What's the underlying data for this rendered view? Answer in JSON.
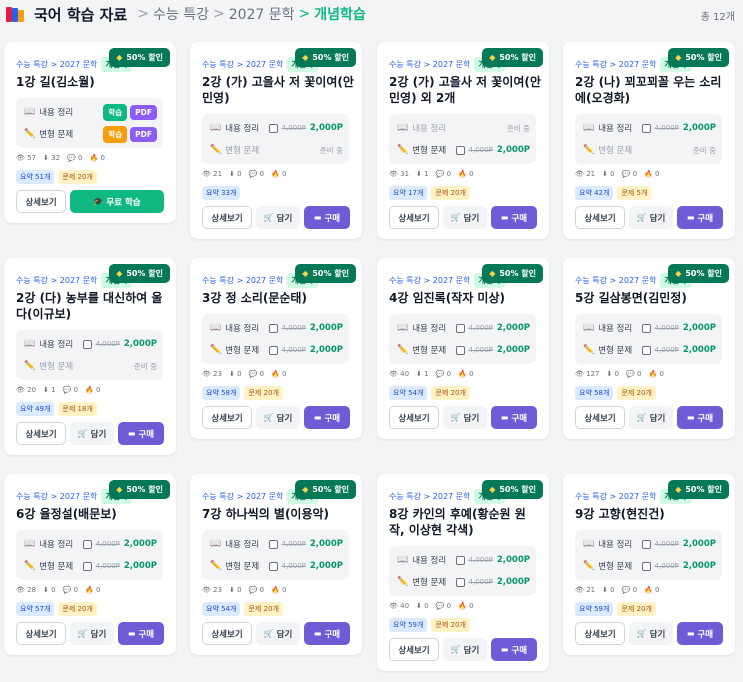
{
  "header": {
    "title": "국어 학습 자료",
    "crumbs": [
      "수능 특강",
      "2027 문학",
      "개념학습"
    ],
    "total": "총 12개"
  },
  "common": {
    "path": "수능 특강 > 2027 문학",
    "tag": "개념학",
    "discount": "50% 할인",
    "summary_label": "내용 정리",
    "variant_label": "변형 문제",
    "orig_price": "4,000P",
    "price": "2,000P",
    "coming_soon": "준비 중",
    "learn_pill": "학습",
    "pdf_pill": "PDF",
    "detail_btn": "상세보기",
    "cart_btn": "담기",
    "buy_btn": "구매",
    "free_btn": "무료 학습"
  },
  "cards": [
    {
      "title": "1강 길(김소월)",
      "views": "57",
      "downloads": "32",
      "comments": "0",
      "likes": "0",
      "summary": "요약 51개",
      "problems": "문제 20개"
    },
    {
      "title": "2강 (가) 고을사 저 꽃이여(안민영)",
      "views": "21",
      "downloads": "0",
      "comments": "0",
      "likes": "0",
      "summary": "요약 33개"
    },
    {
      "title": "2강 (가) 고을사 저 꽃이여(안민영) 외 2개",
      "views": "31",
      "downloads": "1",
      "comments": "0",
      "likes": "0",
      "summary": "요약 17개",
      "problems": "문제 20개"
    },
    {
      "title": "2강 (나) 꾀꼬꾀꼴 우는 소리에(오경화)",
      "views": "21",
      "downloads": "0",
      "comments": "0",
      "likes": "0",
      "summary": "요약 42개",
      "problems": "문제 5개"
    },
    {
      "title": "2강 (다) 농부를 대신하여 울다(이규보)",
      "views": "20",
      "downloads": "1",
      "comments": "0",
      "likes": "0",
      "summary": "요약 49개",
      "problems": "문제 18개"
    },
    {
      "title": "3강 정 소리(문순태)",
      "views": "23",
      "downloads": "0",
      "comments": "0",
      "likes": "0",
      "summary": "요약 58개",
      "problems": "문제 20개"
    },
    {
      "title": "4강 임진록(작자 미상)",
      "views": "40",
      "downloads": "1",
      "comments": "0",
      "likes": "0",
      "summary": "요약 54개",
      "problems": "문제 20개"
    },
    {
      "title": "5강 길삼봉면(김민정)",
      "views": "127",
      "downloads": "0",
      "comments": "0",
      "likes": "0",
      "summary": "요약 58개",
      "problems": "문제 20개"
    },
    {
      "title": "6강 율정설(배문보)",
      "views": "28",
      "downloads": "0",
      "comments": "0",
      "likes": "0",
      "summary": "요약 57개",
      "problems": "문제 20개"
    },
    {
      "title": "7강 하나씩의 별(이용악)",
      "views": "23",
      "downloads": "0",
      "comments": "0",
      "likes": "0",
      "summary": "요약 54개",
      "problems": "문제 20개"
    },
    {
      "title": "8강 카인의 후예(황순원 원작, 이상현 각색)",
      "views": "40",
      "downloads": "0",
      "comments": "0",
      "likes": "0",
      "summary": "요약 59개",
      "problems": "문제 20개"
    },
    {
      "title": "9강 고향(현진건)",
      "views": "21",
      "downloads": "0",
      "comments": "0",
      "likes": "0",
      "summary": "요약 59개",
      "problems": "문제 20개"
    }
  ]
}
